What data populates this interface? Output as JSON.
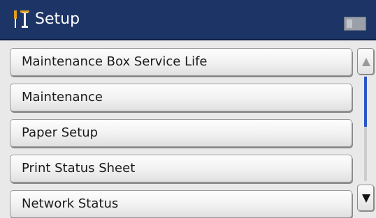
{
  "header": {
    "title": "Setup",
    "icon": "tools-icon",
    "colors": {
      "background": "#1d3466",
      "text": "#ffffff"
    }
  },
  "menu": {
    "items": [
      {
        "label": "Maintenance Box Service Life"
      },
      {
        "label": "Maintenance"
      },
      {
        "label": "Paper Setup"
      },
      {
        "label": "Print Status Sheet"
      },
      {
        "label": "Network Status"
      }
    ]
  },
  "scrollbar": {
    "up_icon": "arrow-up-icon",
    "down_icon": "arrow-down-icon",
    "thumb_color": "#2a55c8",
    "position_fraction": 0.0
  }
}
